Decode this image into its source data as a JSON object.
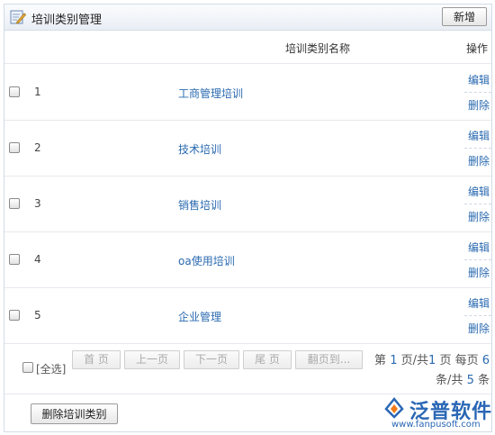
{
  "panel": {
    "title": "培训类别管理",
    "new_button": "新增"
  },
  "table": {
    "columns": {
      "name": "培训类别名称",
      "operation": "操作"
    },
    "rows": [
      {
        "index": "1",
        "name": "工商管理培训",
        "edit": "编辑",
        "delete": "删除"
      },
      {
        "index": "2",
        "name": "技术培训",
        "edit": "编辑",
        "delete": "删除"
      },
      {
        "index": "3",
        "name": "销售培训",
        "edit": "编辑",
        "delete": "删除"
      },
      {
        "index": "4",
        "name": "oa使用培训",
        "edit": "编辑",
        "delete": "删除"
      },
      {
        "index": "5",
        "name": "企业管理",
        "edit": "编辑",
        "delete": "删除"
      }
    ]
  },
  "pager": {
    "select_all": "[全选]",
    "first": "首 页",
    "prev": "上一页",
    "next": "下一页",
    "last": "尾 页",
    "jump": "翻页到...",
    "info_prefix": "第",
    "current_page": "1",
    "info_mid1": "页/共",
    "total_pages": "1",
    "info_mid2": "页 每页",
    "per_page": "6",
    "info_mid3": "条/共",
    "total_items": "5",
    "info_suffix": "条"
  },
  "footer": {
    "delete_button": "删除培训类别"
  },
  "logo": {
    "name": "泛普软件",
    "url": "www.fanpusoft.com"
  },
  "colors": {
    "link": "#2a6ab0",
    "logo": "#2a67b5",
    "accent": "#f07a1a"
  }
}
